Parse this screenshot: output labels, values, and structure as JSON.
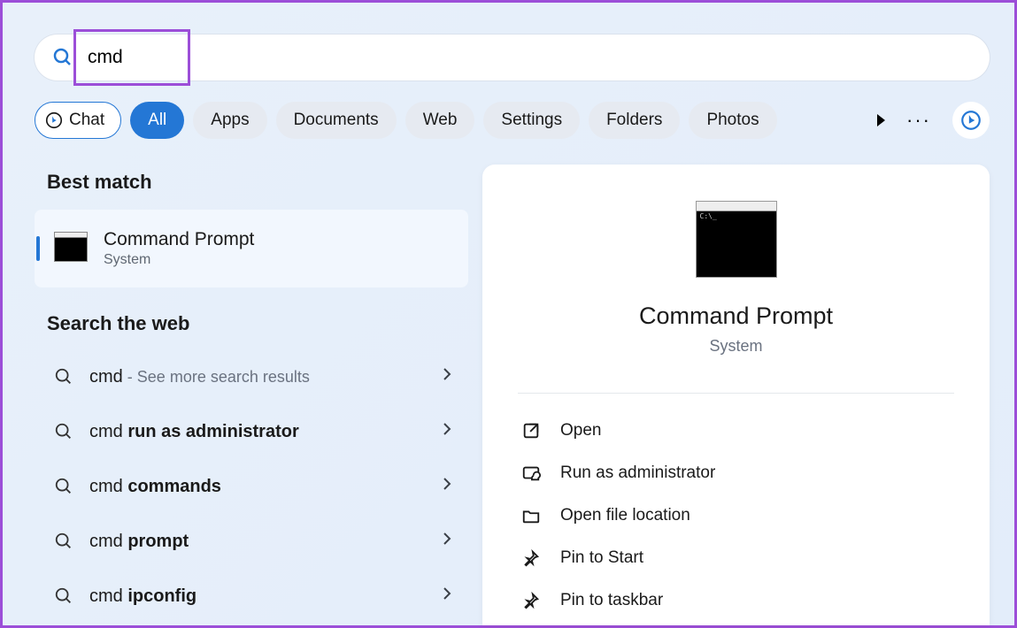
{
  "search": {
    "value": "cmd"
  },
  "filters": {
    "chat": "Chat",
    "tabs": [
      "All",
      "Apps",
      "Documents",
      "Web",
      "Settings",
      "Folders",
      "Photos"
    ],
    "active_index": 0
  },
  "left": {
    "best_match_heading": "Best match",
    "best_match": {
      "title": "Command Prompt",
      "subtitle": "System"
    },
    "web_heading": "Search the web",
    "web_items": [
      {
        "prefix": "cmd",
        "bold": "",
        "suffix": " - See more search results",
        "suffix_muted": true
      },
      {
        "prefix": "cmd ",
        "bold": "run as administrator",
        "suffix": "",
        "suffix_muted": false
      },
      {
        "prefix": "cmd ",
        "bold": "commands",
        "suffix": "",
        "suffix_muted": false
      },
      {
        "prefix": "cmd ",
        "bold": "prompt",
        "suffix": "",
        "suffix_muted": false
      },
      {
        "prefix": "cmd ",
        "bold": "ipconfig",
        "suffix": "",
        "suffix_muted": false
      }
    ]
  },
  "right": {
    "title": "Command Prompt",
    "subtitle": "System",
    "actions": [
      {
        "icon": "open",
        "label": "Open"
      },
      {
        "icon": "admin",
        "label": "Run as administrator"
      },
      {
        "icon": "folder",
        "label": "Open file location"
      },
      {
        "icon": "pin",
        "label": "Pin to Start"
      },
      {
        "icon": "pin",
        "label": "Pin to taskbar"
      }
    ]
  }
}
